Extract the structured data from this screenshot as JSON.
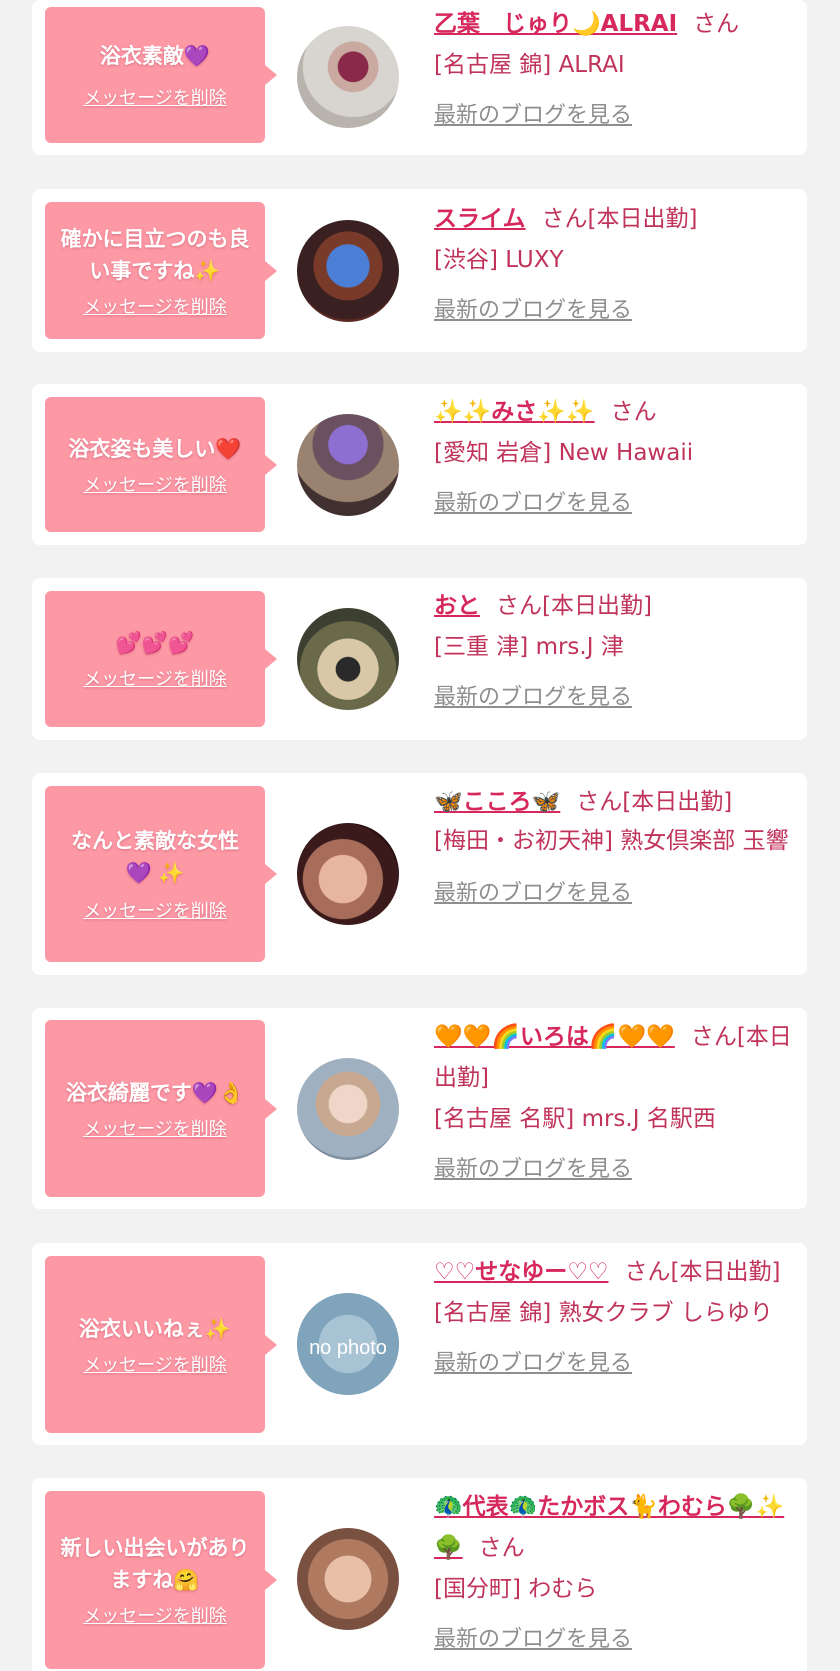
{
  "delete_label": "メッセージを削除",
  "blog_label": "最新のブログを見る",
  "cards": [
    {
      "message": "浴衣素敵",
      "message_emoji": "💜",
      "name": "乙葉　じゅり🌙ALRAI",
      "suffix": "さん",
      "shop": "[名古屋 錦] ALRAI"
    },
    {
      "message": "確かに目立つのも良い事ですね",
      "message_emoji": "✨",
      "name": "スライム",
      "suffix": "さん[本日出勤]",
      "shop": "[渋谷] LUXY"
    },
    {
      "message": "浴衣姿も美しい",
      "message_emoji": "❤️",
      "name": "✨✨みさ✨✨",
      "suffix": "さん",
      "shop": "[愛知 岩倉] New Hawaii"
    },
    {
      "message": "",
      "message_emoji": "💕💕💕",
      "name": "おと",
      "suffix": "さん[本日出勤]",
      "shop": "[三重 津] mrs.J 津"
    },
    {
      "message": "なんと素敵な女性",
      "message_emoji": "💜 ✨",
      "name": "🦋こころ🦋",
      "suffix": "さん[本日出勤]",
      "shop": "[梅田・お初天神] 熟女倶楽部 玉響"
    },
    {
      "message": "浴衣綺麗です",
      "message_emoji": "💜👌",
      "name": "🧡🧡🌈いろは🌈🧡🧡",
      "suffix": "さん[本日出勤]",
      "shop": "[名古屋 名駅] mrs.J 名駅西"
    },
    {
      "message": "浴衣いいねぇ",
      "message_emoji": "✨",
      "name": "♡♡せなゆー♡♡",
      "suffix": "さん[本日出勤]",
      "shop": "[名古屋 錦] 熟女クラブ しらゆり",
      "avatar_text": "no photo"
    },
    {
      "message": "新しい出会いがありますね",
      "message_emoji": "🤗",
      "name": "🦚代表🦚たかボス🐈わむら🌳✨🌳",
      "suffix": "さん",
      "shop": "[国分町] わむら"
    }
  ],
  "colors": {
    "page_bg": "#f2f2f2",
    "card_bg": "#ffffff",
    "bubble_bg": "#fd98a5",
    "name_color": "#d6285c",
    "text_pink": "#c0335b",
    "blog_gray": "#8e8e8e"
  }
}
